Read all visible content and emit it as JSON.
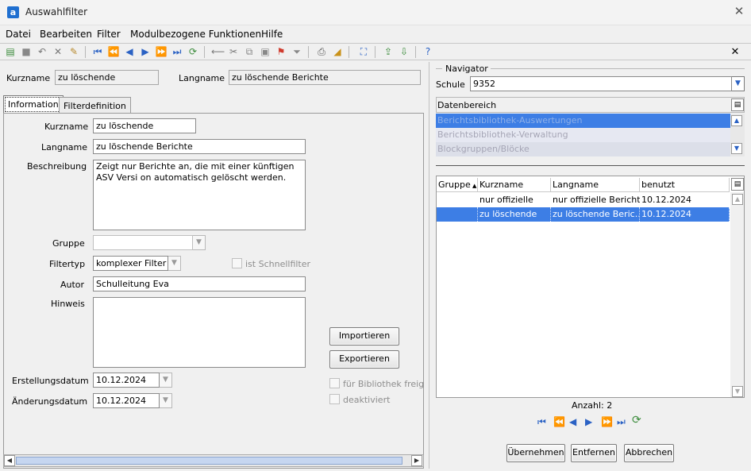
{
  "window": {
    "title": "Auswahlfilter",
    "app_icon": "a",
    "close": "✕"
  },
  "menu": [
    {
      "label": "Datei"
    },
    {
      "label": "Bearbeiten"
    },
    {
      "label": "Filter"
    },
    {
      "label": "Modulbezogene Funktionen"
    },
    {
      "label": "Hilfe"
    }
  ],
  "toolbar": {
    "icons": [
      "new-icon",
      "save-icon",
      "undo-icon",
      "delete-icon",
      "edit-icon",
      "first-icon",
      "previous-page-icon",
      "previous-icon",
      "next-icon",
      "next-page-icon",
      "last-icon",
      "refresh-icon",
      "back-icon",
      "cut-icon",
      "copy-icon",
      "paste-icon",
      "flag-icon",
      "filter-icon",
      "print-icon",
      "clear-icon",
      "select-icon",
      "upload-icon",
      "download-icon",
      "help-icon"
    ],
    "close_label": "✕",
    "accent": "#2b62c4"
  },
  "header": {
    "kurzname_label": "Kurzname",
    "kurzname_value": "zu löschende",
    "langname_label": "Langname",
    "langname_value": "zu löschende Berichte"
  },
  "tabs": [
    {
      "label": "Information",
      "active": true
    },
    {
      "label": "Filterdefinition",
      "active": false
    }
  ],
  "info": {
    "kurzname_label": "Kurzname",
    "kurzname_value": "zu löschende",
    "langname_label": "Langname",
    "langname_value": "zu löschende Berichte",
    "beschreibung_label": "Beschreibung",
    "beschreibung_value": "Zeigt nur Berichte an, die mit einer künftigen ASV Versi on automatisch gelöscht werden.",
    "gruppe_label": "Gruppe",
    "gruppe_value": "",
    "filtertyp_label": "Filtertyp",
    "filtertyp_value": "komplexer Filter",
    "schnellfilter_label": "ist Schnellfilter",
    "autor_label": "Autor",
    "autor_value": "Schulleitung Eva",
    "hinweis_label": "Hinweis",
    "hinweis_value": "",
    "importieren_label": "Importieren",
    "exportieren_label": "Exportieren",
    "erstellungsdatum_label": "Erstellungsdatum",
    "erstellungsdatum_value": "10.12.2024",
    "aenderungsdatum_label": "Änderungsdatum",
    "aenderungsdatum_value": "10.12.2024",
    "bibliothek_label": "für Bibliothek freige",
    "deaktiviert_label": "deaktiviert"
  },
  "navigator": {
    "title": "Navigator",
    "schule_label": "Schule",
    "schule_value": "9352",
    "datenbereich_label": "Datenbereich",
    "datenbereich_items": [
      {
        "label": "Berichtsbibliothek-Auswertungen",
        "selected": true
      },
      {
        "label": "Berichtsbibliothek-Verwaltung",
        "selected": false
      },
      {
        "label": "Blockgruppen/Blöcke",
        "selected": false
      }
    ],
    "columns": [
      "Gruppe",
      "Kurzname",
      "Langname",
      "benutzt"
    ],
    "rows": [
      {
        "gruppe": "",
        "kurzname": "nur offizielle",
        "langname": "nur offizielle Berichte",
        "benutzt": "10.12.2024",
        "selected": false
      },
      {
        "gruppe": "",
        "kurzname": "zu löschende",
        "langname": "zu löschende Beric...",
        "benutzt": "10.12.2024",
        "selected": true
      }
    ],
    "anzahl": "Anzahl: 2",
    "buttons": {
      "uebernehmen": "Übernehmen",
      "entfernen": "Entfernen",
      "abbrechen": "Abbrechen"
    }
  }
}
